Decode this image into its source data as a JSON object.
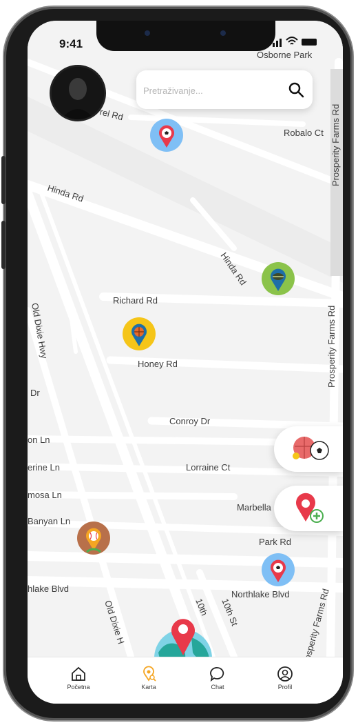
{
  "status_bar": {
    "time": "9:41"
  },
  "search": {
    "placeholder": "Pretraživanje..."
  },
  "map": {
    "place_labels": {
      "osborne_park": "Osborne Park",
      "robalo_ct": "Robalo Ct",
      "prosperity_farms_rd_top": "Prosperity Farms Rd",
      "prosperity_farms_rd_mid": "Prosperity Farms Rd",
      "prosperity_farms_rd_bottom": "Prosperity Farms Rd",
      "laurel_rd": "rel Rd",
      "hinda_rd_left": "Hinda Rd",
      "hinda_rd_right": "Hinda Rd",
      "richard_rd": "Richard Rd",
      "old_dixie_hwy_left": "Old Dixie Hwy",
      "honey_rd": "Honey Rd",
      "dr": "Dr",
      "conroy_dr": "Conroy Dr",
      "on_ln": "on Ln",
      "erine_ln": "erine Ln",
      "lorraine_ct": "Lorraine Ct",
      "mosa_ln": "mosa Ln",
      "marbella": "Marbella",
      "banyan_ln": "Banyan Ln",
      "park_rd": "Park Rd",
      "northlake_blvd_left": "hlake Blvd",
      "northlake_blvd_right": "Northlake Blvd",
      "old_dixie_bottom": "Old Dixie H",
      "tenth_st_a": "10th",
      "tenth_st_b": "10th St"
    }
  },
  "markers": [
    {
      "sport": "soccer",
      "color": "#7fbff5"
    },
    {
      "sport": "tennis",
      "color": "#8bc34a"
    },
    {
      "sport": "basketball",
      "color": "#f5c518"
    },
    {
      "sport": "baseball",
      "color": "#b8704a"
    },
    {
      "sport": "soccer",
      "color": "#7fbff5"
    }
  ],
  "side_actions": [
    {
      "name": "sports-filter",
      "icons": [
        "basketball-icon",
        "soccer-ball-icon"
      ]
    },
    {
      "name": "add-location",
      "icons": [
        "location-pin-icon",
        "plus-icon"
      ]
    }
  ],
  "nav": {
    "items": [
      {
        "label": "Početna",
        "icon": "home-icon"
      },
      {
        "label": "Karta",
        "icon": "map-search-icon",
        "active": true
      },
      {
        "label": "Chat",
        "icon": "chat-bubble-icon"
      },
      {
        "label": "Profil",
        "icon": "profile-icon"
      }
    ]
  },
  "colors": {
    "accent": "#f5a623",
    "pin_red": "#e8394a",
    "map_bg": "#f3f3f3"
  }
}
